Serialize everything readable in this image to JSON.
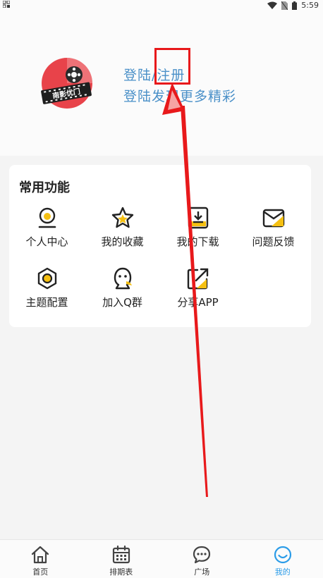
{
  "status_bar": {
    "time": "5:59"
  },
  "header": {
    "login_link": "登陆/注册",
    "login_subtitle": "登陆发现更多精彩",
    "avatar_logo_text": "南影优门"
  },
  "functions_card": {
    "title": "常用功能",
    "items": [
      {
        "label": "个人中心",
        "icon": "person-center-icon"
      },
      {
        "label": "我的收藏",
        "icon": "star-favorites-icon"
      },
      {
        "label": "我的下载",
        "icon": "download-icon"
      },
      {
        "label": "问题反馈",
        "icon": "feedback-mail-icon"
      },
      {
        "label": "主题配置",
        "icon": "theme-hexagon-icon"
      },
      {
        "label": "加入Q群",
        "icon": "qq-penguin-icon"
      },
      {
        "label": "分享APP",
        "icon": "share-icon"
      }
    ]
  },
  "bottom_nav": {
    "items": [
      {
        "label": "首页",
        "icon": "home-icon"
      },
      {
        "label": "排期表",
        "icon": "calendar-icon"
      },
      {
        "label": "广场",
        "icon": "chat-bubble-icon"
      },
      {
        "label": "我的",
        "icon": "smiley-icon"
      }
    ],
    "active_index": 3
  },
  "colors": {
    "accent_blue": "#2b9ce8",
    "link_blue": "#4a90c8",
    "icon_yellow": "#f5c012",
    "annotation_red": "#e8191b"
  }
}
